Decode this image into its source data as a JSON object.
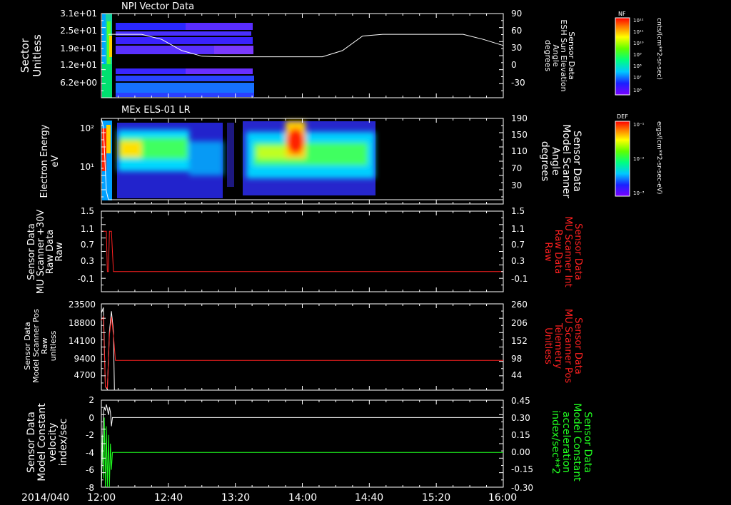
{
  "chart_data": [
    {
      "type": "heatmap",
      "title": "NPI Vector Data",
      "ylabel_lines": [
        "Sector",
        "Unitless"
      ],
      "yticks": [
        "3.1e+01",
        "2.5e+01",
        "1.9e+01",
        "1.2e+01",
        "6.2e+00"
      ],
      "right_ylabel_lines": [
        "Sensor Data",
        "ESH Sun Elevation",
        "Angle",
        "degrees"
      ],
      "right_yticks": [
        "90",
        "60",
        "30",
        "0",
        "-30"
      ],
      "right_ylim": [
        -60,
        90
      ],
      "overlay_series": {
        "name": "ESH Sun Elevation",
        "x_hours": [
          12.07,
          12.08,
          12.4,
          12.6,
          12.8,
          13.0,
          13.2,
          13.4,
          13.6,
          13.8,
          14.0,
          14.2,
          14.4,
          14.6,
          14.8,
          15.0,
          15.2,
          15.4,
          15.6,
          15.8,
          16.0
        ],
        "values": [
          52,
          53,
          53,
          44,
          24,
          14,
          13,
          13,
          13,
          13,
          13,
          13,
          24,
          50,
          53,
          53,
          53,
          53,
          53,
          44,
          33
        ]
      },
      "colorbar": {
        "label": "NF",
        "unit": "cnts/(cm**2-sr-sec)",
        "ticks": [
          "10¹²",
          "10¹¹",
          "10¹⁰",
          "10⁹",
          "10⁸",
          "10⁷",
          "10⁶"
        ]
      }
    },
    {
      "type": "heatmap",
      "title": "MEx ELS-01 LR",
      "ylabel_lines": [
        "Electron Energy",
        "eV"
      ],
      "yticks": [
        "10²",
        "10¹"
      ],
      "right_ylabel_lines": [
        "Sensor Data",
        "Model Scanner",
        "Angle",
        "degrees"
      ],
      "right_yticks": [
        "190",
        "150",
        "110",
        "70",
        "30"
      ],
      "right_ylim": [
        -10,
        190
      ],
      "overlay_series": {
        "name": "Model Scanner Angle",
        "x_hours": [
          12.0,
          12.02,
          12.05,
          12.07,
          12.09,
          16.0
        ],
        "values": [
          190,
          170,
          20,
          0,
          0,
          0
        ]
      },
      "colorbar": {
        "label": "DEF",
        "unit": "ergs/(cm**2-sr-sec-eV)",
        "ticks": [
          "10⁻¹",
          "10⁻²",
          "10⁻³"
        ]
      }
    },
    {
      "type": "line",
      "ylabel_lines": [
        "Sensor Data",
        "MU Scanner +30V",
        "Raw Data",
        "Raw"
      ],
      "yticks": [
        "1.5",
        "1.1",
        "0.7",
        "0.3",
        "-0.1"
      ],
      "ylim": [
        -0.5,
        1.5
      ],
      "right_ylabel_lines": [
        "Sensor Data",
        "MU Scanner Int",
        "Raw Data",
        "Raw"
      ],
      "right_yticks": [
        "1.5",
        "1.1",
        "0.7",
        "0.3",
        "-0.1"
      ],
      "series": [
        {
          "name": "MU Scanner Int",
          "color": "#ff2020",
          "x_hours": [
            12.0,
            12.05,
            12.06,
            12.07,
            12.08,
            12.1,
            12.11,
            12.12,
            12.13,
            16.0
          ],
          "values": [
            1.0,
            1.0,
            0.0,
            0.0,
            1.0,
            1.0,
            0.5,
            0.0,
            0.0,
            0.0
          ]
        }
      ]
    },
    {
      "type": "line",
      "ylabel_lines": [
        "Sensor Data",
        "Model Scanner Pos",
        "Raw",
        "unitless"
      ],
      "yticks": [
        "23500",
        "18800",
        "14100",
        "9400",
        "4700"
      ],
      "ylim": [
        0,
        23500
      ],
      "right_ylabel_lines": [
        "Sensor Data",
        "MU Scanner Pos",
        "Telemetry",
        "Unitless"
      ],
      "right_yticks": [
        "260",
        "206",
        "152",
        "98",
        "44"
      ],
      "series": [
        {
          "name": "Model Scanner Pos",
          "color": "#ffffff",
          "x_hours": [
            12.0,
            12.02,
            12.04,
            12.06,
            12.08,
            12.1,
            12.12,
            12.13,
            16.0
          ],
          "values": [
            21000,
            22500,
            1000,
            200,
            16000,
            21500,
            16000,
            0,
            0
          ]
        },
        {
          "name": "MU Scanner Pos",
          "color": "#ff2020",
          "x_hours": [
            12.0,
            12.02,
            12.04,
            12.06,
            12.08,
            12.1,
            12.12,
            12.14,
            16.0
          ],
          "values": [
            19000,
            20000,
            1000,
            500,
            15000,
            20000,
            15000,
            8100,
            8100
          ]
        }
      ]
    },
    {
      "type": "line",
      "ylabel_lines": [
        "Sensor Data",
        "Model Constant",
        "velocity",
        "index/sec"
      ],
      "yticks": [
        "2",
        "0",
        "-2",
        "-4",
        "-6",
        "-8"
      ],
      "ylim": [
        -8,
        2
      ],
      "right_ylabel_lines": [
        "Sensor Data",
        "Model Constant",
        "acceleration",
        "index/sec**2"
      ],
      "right_yticks": [
        "0.45",
        "0.30",
        "0.15",
        "0.00",
        "-0.15",
        "-0.30"
      ],
      "series": [
        {
          "name": "Model Constant velocity",
          "color": "#ffffff",
          "x_hours": [
            12.0,
            12.02,
            12.03,
            12.04,
            12.05,
            12.06,
            12.07,
            12.08,
            12.09,
            12.1,
            12.11,
            16.0
          ],
          "values": [
            -8,
            0.5,
            1.2,
            0.8,
            1.5,
            1.0,
            0.3,
            1.2,
            0.6,
            -1,
            0,
            0
          ]
        },
        {
          "name": "Model Constant acceleration",
          "color": "#20ff20",
          "x_hours": [
            12.0,
            12.01,
            12.02,
            12.03,
            12.04,
            12.05,
            12.06,
            12.07,
            12.08,
            12.09,
            12.1,
            12.11,
            12.12,
            16.0
          ],
          "values": [
            -8,
            -2,
            -7,
            0,
            -8,
            -1,
            -8,
            -2,
            -8,
            -3,
            -6,
            -4,
            -4,
            -4
          ]
        }
      ]
    }
  ],
  "xaxis": {
    "date_label": "2014/040",
    "ticks": [
      "12:00",
      "12:40",
      "13:20",
      "14:00",
      "14:40",
      "15:20",
      "16:00"
    ],
    "range_hours": [
      12,
      16
    ]
  }
}
